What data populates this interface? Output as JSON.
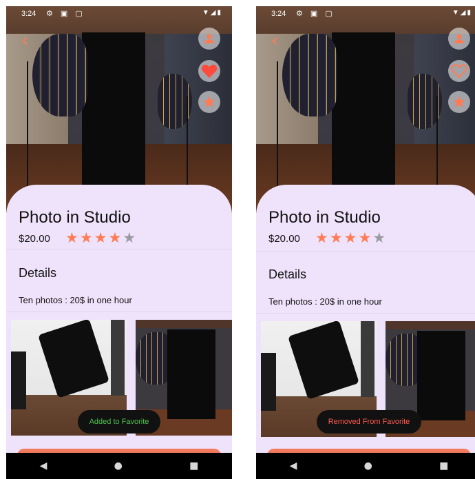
{
  "screens": [
    {
      "status_time": "3:24",
      "title": "Photo in Studio",
      "price": "$20.00",
      "rating": 4,
      "rating_max": 5,
      "details_heading": "Details",
      "description": "Ten photos : 20$ in one hour",
      "favorite_icon": "heart-filled",
      "toast": "Added to Favorite",
      "toast_color": "#4fc24f"
    },
    {
      "status_time": "3:24",
      "title": "Photo in Studio",
      "price": "$20.00",
      "rating": 4,
      "rating_max": 5,
      "details_heading": "Details",
      "description": "Ten photos : 20$ in one hour",
      "favorite_icon": "heart-outline",
      "toast": "Removed From Favorite",
      "toast_color": "#ff5a4d"
    }
  ],
  "colors": {
    "accent": "#ff7b54",
    "sheet_background": "#efe3fb",
    "star_inactive": "#9a9aa3",
    "cta": "#f27b5f"
  },
  "icons": {
    "back": "chevron-left-icon",
    "user": "person-icon",
    "favorite": "heart-icon",
    "rate": "star-icon",
    "nav_back": "triangle-back-icon",
    "nav_home": "circle-home-icon",
    "nav_recents": "square-recents-icon"
  }
}
